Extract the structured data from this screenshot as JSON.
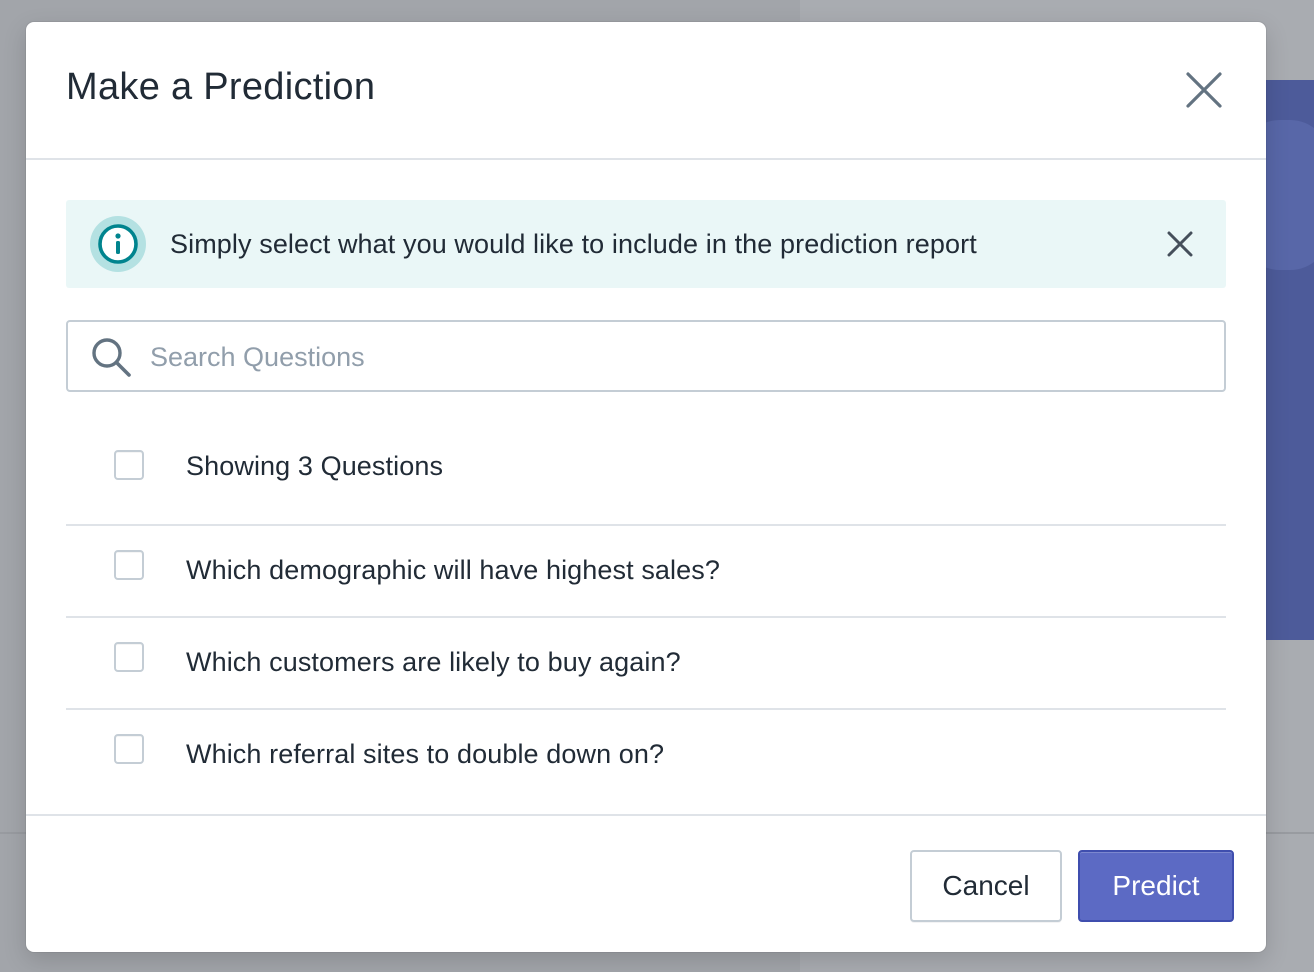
{
  "modal": {
    "title": "Make a Prediction",
    "close_icon": "close-icon"
  },
  "banner": {
    "icon": "info-icon",
    "text": "Simply select what you would like to include in the prediction report",
    "dismiss_icon": "close-icon",
    "color_bg": "#eaf7f7",
    "color_icon": "#00848e"
  },
  "search": {
    "icon": "search-icon",
    "placeholder": "Search Questions",
    "value": ""
  },
  "list": {
    "header_label": "Showing 3 Questions",
    "header_checked": false,
    "questions": [
      {
        "label": "Which demographic will have highest sales?",
        "checked": false
      },
      {
        "label": "Which customers are likely to buy again?",
        "checked": false
      },
      {
        "label": "Which referral sites to double down on?",
        "checked": false
      }
    ]
  },
  "footer": {
    "cancel_label": "Cancel",
    "predict_label": "Predict",
    "color_primary": "#5c6ac4"
  }
}
